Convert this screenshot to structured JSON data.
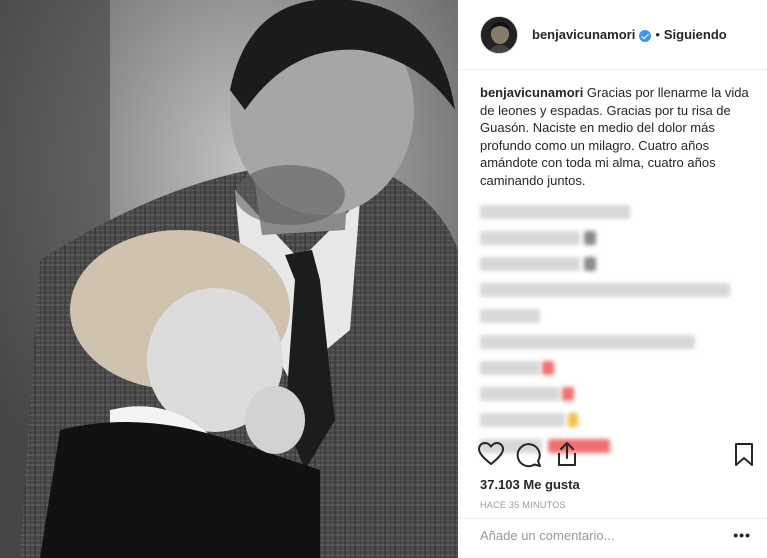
{
  "post": {
    "username": "benjavicunamori",
    "follow_separator": "•",
    "follow_status": "Siguiendo",
    "caption_user": "benjavicunamori",
    "caption_text": " Gracias por llenarme la vida de leones y espadas. Gracias por tu risa de Guasón. Naciste en medio del dolor más profundo como un milagro. Cuatro años amándote con toda mi alma, cuatro años caminando juntos.",
    "likes": "37.103 Me gusta",
    "time_ago": "HACE 35 MINUTOS",
    "comment_placeholder": "Añade un comentario...",
    "more_label": "•••"
  },
  "icons": {
    "verified": "verified-badge-icon",
    "like": "heart-icon",
    "comment": "comment-bubble-icon",
    "share": "share-icon",
    "save": "bookmark-icon"
  },
  "colors": {
    "verified_blue": "#3897f0",
    "blurred_emoji_red": "#f07070",
    "blurred_emoji_yellow": "#f1c04a"
  }
}
